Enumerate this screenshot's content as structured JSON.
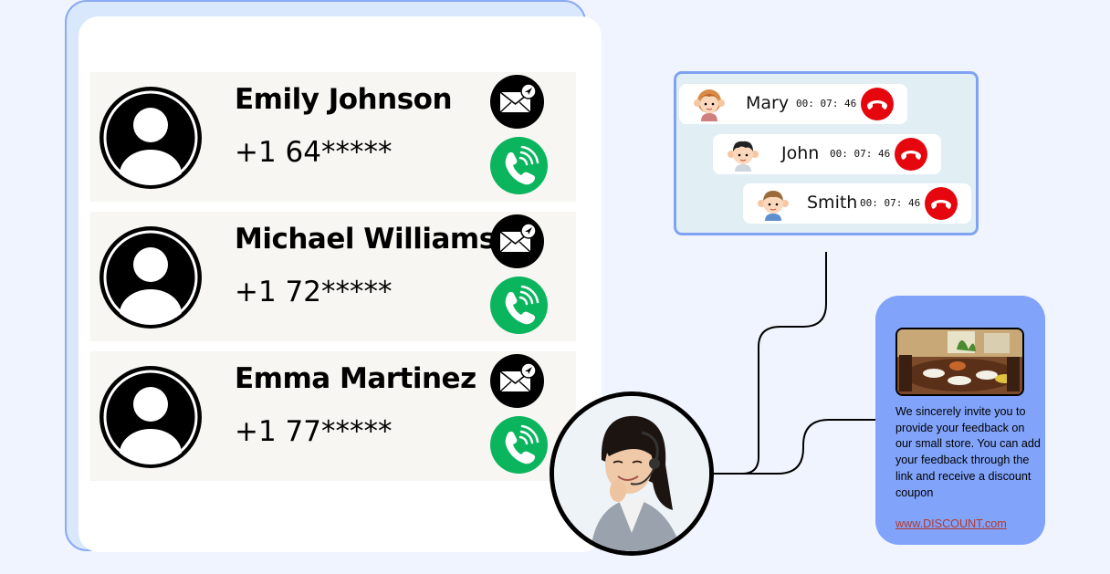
{
  "contacts": [
    {
      "name": "Emily Johnson",
      "phone": "+1 64*****"
    },
    {
      "name": "Michael Williams",
      "phone": "+1 72*****"
    },
    {
      "name": "Emma Martinez",
      "phone": "+1 77*****"
    }
  ],
  "calls": [
    {
      "name": "Mary",
      "time": "00: 07: 46"
    },
    {
      "name": "John",
      "time": "00: 07: 46"
    },
    {
      "name": "Smith",
      "time": "00: 07: 46"
    }
  ],
  "feedback": {
    "message": "We sincerely invite you to provide your feedback on our small store. You can add your feedback through the link and receive a discount coupon",
    "link": "www.DISCOUNT.com"
  },
  "colors": {
    "call_green": "#0bb55e",
    "hangup_red": "#e5060e",
    "panel_border": "#7fa3f2",
    "feedback_bg": "#81a3fa",
    "page_bg": "#f0f4fe"
  },
  "icons": {
    "contact_avatar": "person-icon",
    "message": "mail-send-icon",
    "call": "phone-call-icon",
    "hangup": "phone-hangup-icon"
  }
}
